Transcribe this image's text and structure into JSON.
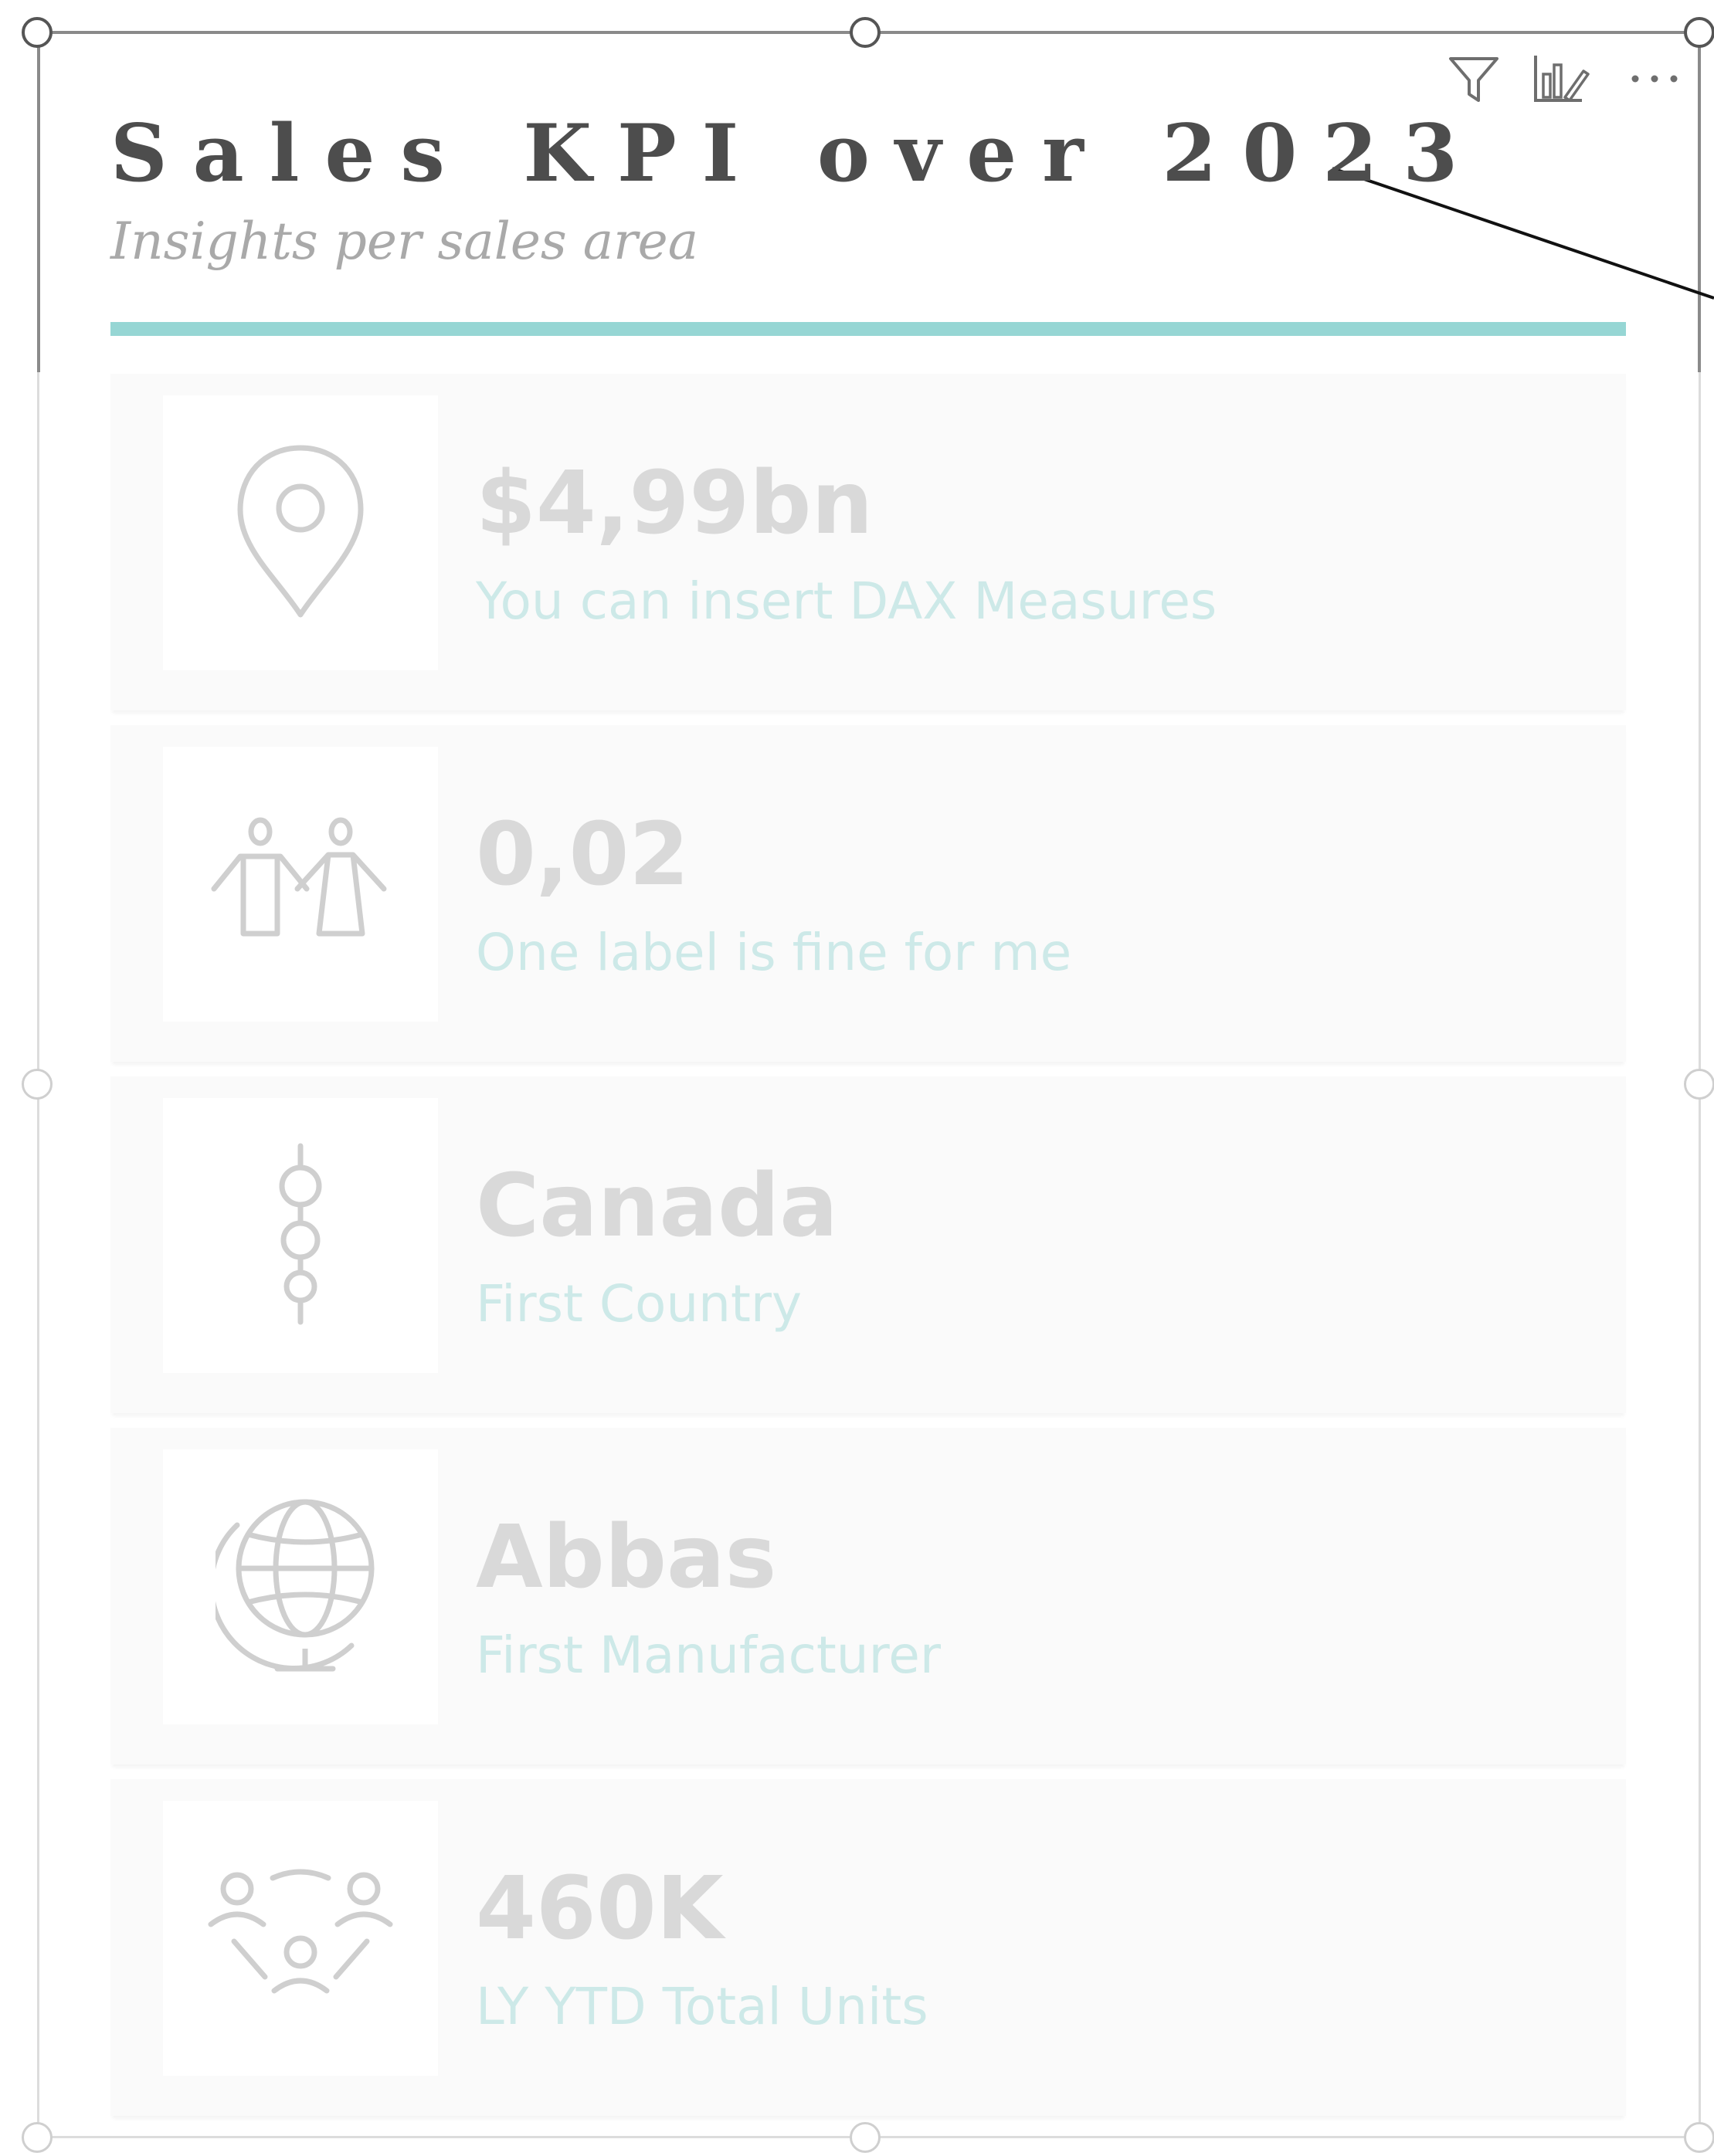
{
  "visual": {
    "title": "Sales KPI over 2023",
    "subtitle": "Insights per sales area",
    "accent_color": "#96d6d4"
  },
  "toolbar": {
    "icons": [
      "filter-icon",
      "focus-mode-icon",
      "more-options-icon"
    ],
    "more_label": "⋯"
  },
  "kpis": [
    {
      "value": "$4,99bn",
      "label": "You can insert DAX Measures",
      "icon": "location-pin-icon"
    },
    {
      "value": "0,02",
      "label": "One label is fine for me",
      "icon": "man-woman-icon"
    },
    {
      "value": "Canada",
      "label": "First Country",
      "icon": "three-circles-vertical-icon"
    },
    {
      "value": "Abbas",
      "label": "First Manufacturer",
      "icon": "globe-icon"
    },
    {
      "value": "460K",
      "label": "LY YTD Total Units",
      "icon": "people-network-icon"
    }
  ],
  "colors": {
    "value_text": "#d9d9d9",
    "label_text": "#cde9e8",
    "card_background": "#fafafa",
    "title_text": "#4d4d4d",
    "subtitle_text": "#a9a9a9"
  }
}
